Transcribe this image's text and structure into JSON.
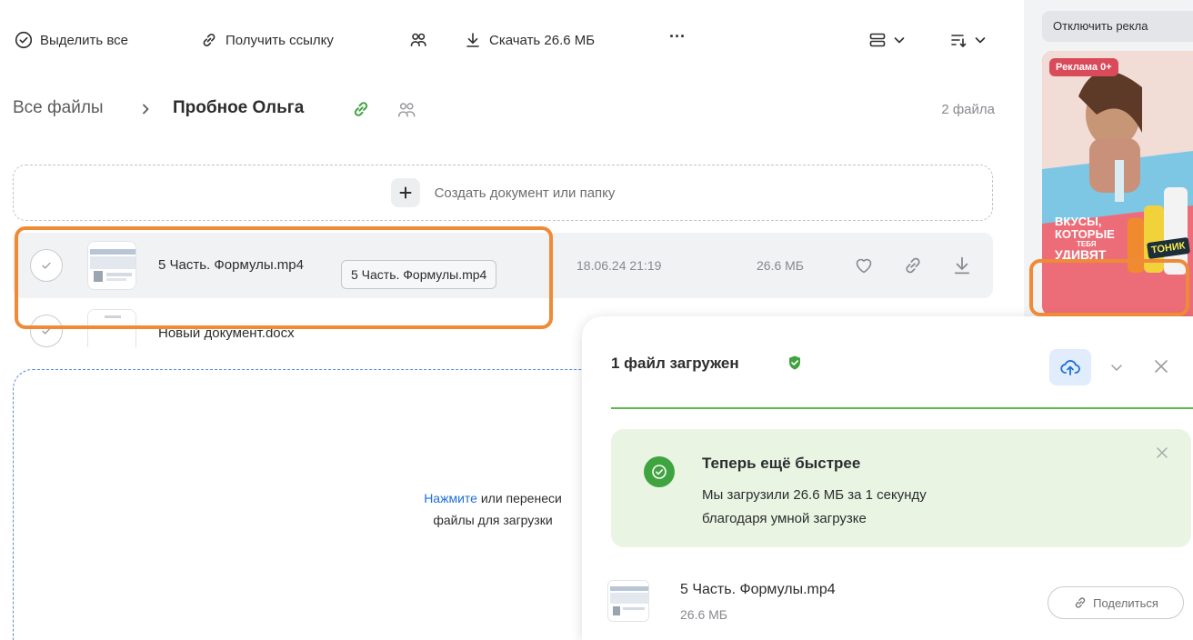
{
  "colors": {
    "accent_blue": "#1f6fd6",
    "success_green": "#3fa33f",
    "highlight_orange": "#ef8a37",
    "ad_pink": "#ec6d78"
  },
  "toolbar": {
    "select_all": {
      "label": "Выделить все",
      "icon": "check-circle-icon"
    },
    "get_link": {
      "label": "Получить ссылку",
      "icon": "link-icon"
    },
    "share_access": {
      "icon": "people-icon"
    },
    "download": {
      "label": "Скачать 26.6 МБ",
      "icon": "download-icon"
    },
    "more": {
      "label": "···",
      "icon": "more-icon"
    },
    "view_toggle": {
      "icon": "list-view-icon"
    },
    "sort_toggle": {
      "icon": "sort-icon"
    }
  },
  "breadcrumb": {
    "root": "Все файлы",
    "separator": ">",
    "current": "Пробное Ольга"
  },
  "file_count": "2 файла",
  "create": {
    "label": "Создать документ или папку"
  },
  "files": [
    {
      "name": "5 Часть. Формулы.mp4",
      "date": "18.06.24 21:19",
      "size": "26.6 МБ"
    },
    {
      "name": "Новый документ.docx"
    }
  ],
  "tooltip": "5 Часть. Формулы.mp4",
  "drop_zone": {
    "link": "Нажмите",
    "text_1": " или перенеси",
    "text_2": "файлы для загрузки"
  },
  "ad": {
    "disable_label": "Отключить рекла",
    "badge": "Реклама 0+",
    "line_1": "ВКУСЫ,",
    "line_2": "КОТОРЫЕ",
    "line_3": "ТЕБЯ",
    "line_4": "УДИВЯТ",
    "brand": "ТОНИК"
  },
  "upload_panel": {
    "title": "1 файл загружен",
    "progress": 1.0,
    "notice": {
      "title": "Теперь ещё быстрее",
      "body": "Мы загрузили 26.6 МБ за 1 секунду благодаря умной загрузке"
    },
    "file": {
      "name": "5 Часть. Формулы.mp4",
      "size": "26.6 МБ"
    },
    "share_label": "Поделиться"
  }
}
